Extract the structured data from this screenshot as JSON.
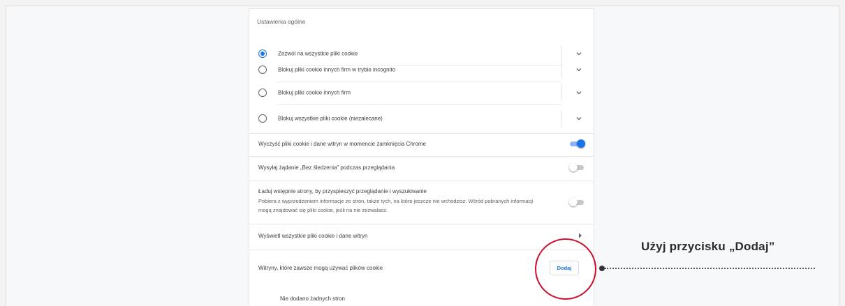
{
  "settings": {
    "section_title": "Ustawienia ogólne",
    "cookie_options": [
      {
        "label": "Zezwól na wszystkie pliki cookie",
        "selected": true
      },
      {
        "label": "Blokuj pliki cookie innych firm w trybie incognito",
        "selected": false
      },
      {
        "label": "Blokuj pliki cookie innych firm",
        "selected": false
      },
      {
        "label": "Blokuj wszystkie pliki cookie (niezalecane)",
        "selected": false
      }
    ],
    "clear_on_exit": {
      "label": "Wyczyść pliki cookie i dane witryn w momencie zamknięcia Chrome",
      "enabled": true
    },
    "do_not_track": {
      "label": "Wysyłaj żądanie „Bez śledzenia” podczas przeglądania",
      "enabled": false
    },
    "preload": {
      "title": "Ładuj wstępnie strony, by przyspieszyć przeglądanie i wyszukiwanie",
      "description": "Pobiera z wyprzedzeniem informacje ze stron, także tych, na które jeszcze nie wchodzisz. Wśród pobranych informacji mogą znajdować się pliki cookie, jeśli na nie zezwalasz.",
      "enabled": false
    },
    "view_all": {
      "label": "Wyświetl wszystkie pliki cookie i dane witryn"
    },
    "allowed_sites": {
      "label": "Witryny, które zawsze mogą używać plików cookie",
      "add_button": "Dodaj",
      "empty_text": "Nie dodano żadnych stron"
    }
  },
  "annotation": {
    "callout_text": "Użyj przycisku „Dodaj”",
    "circle_color": "#c8102e"
  },
  "colors": {
    "accent": "#1a73e8",
    "toggle_on_track": "#8ab4f8",
    "toggle_off_track": "#c7c7c7"
  }
}
